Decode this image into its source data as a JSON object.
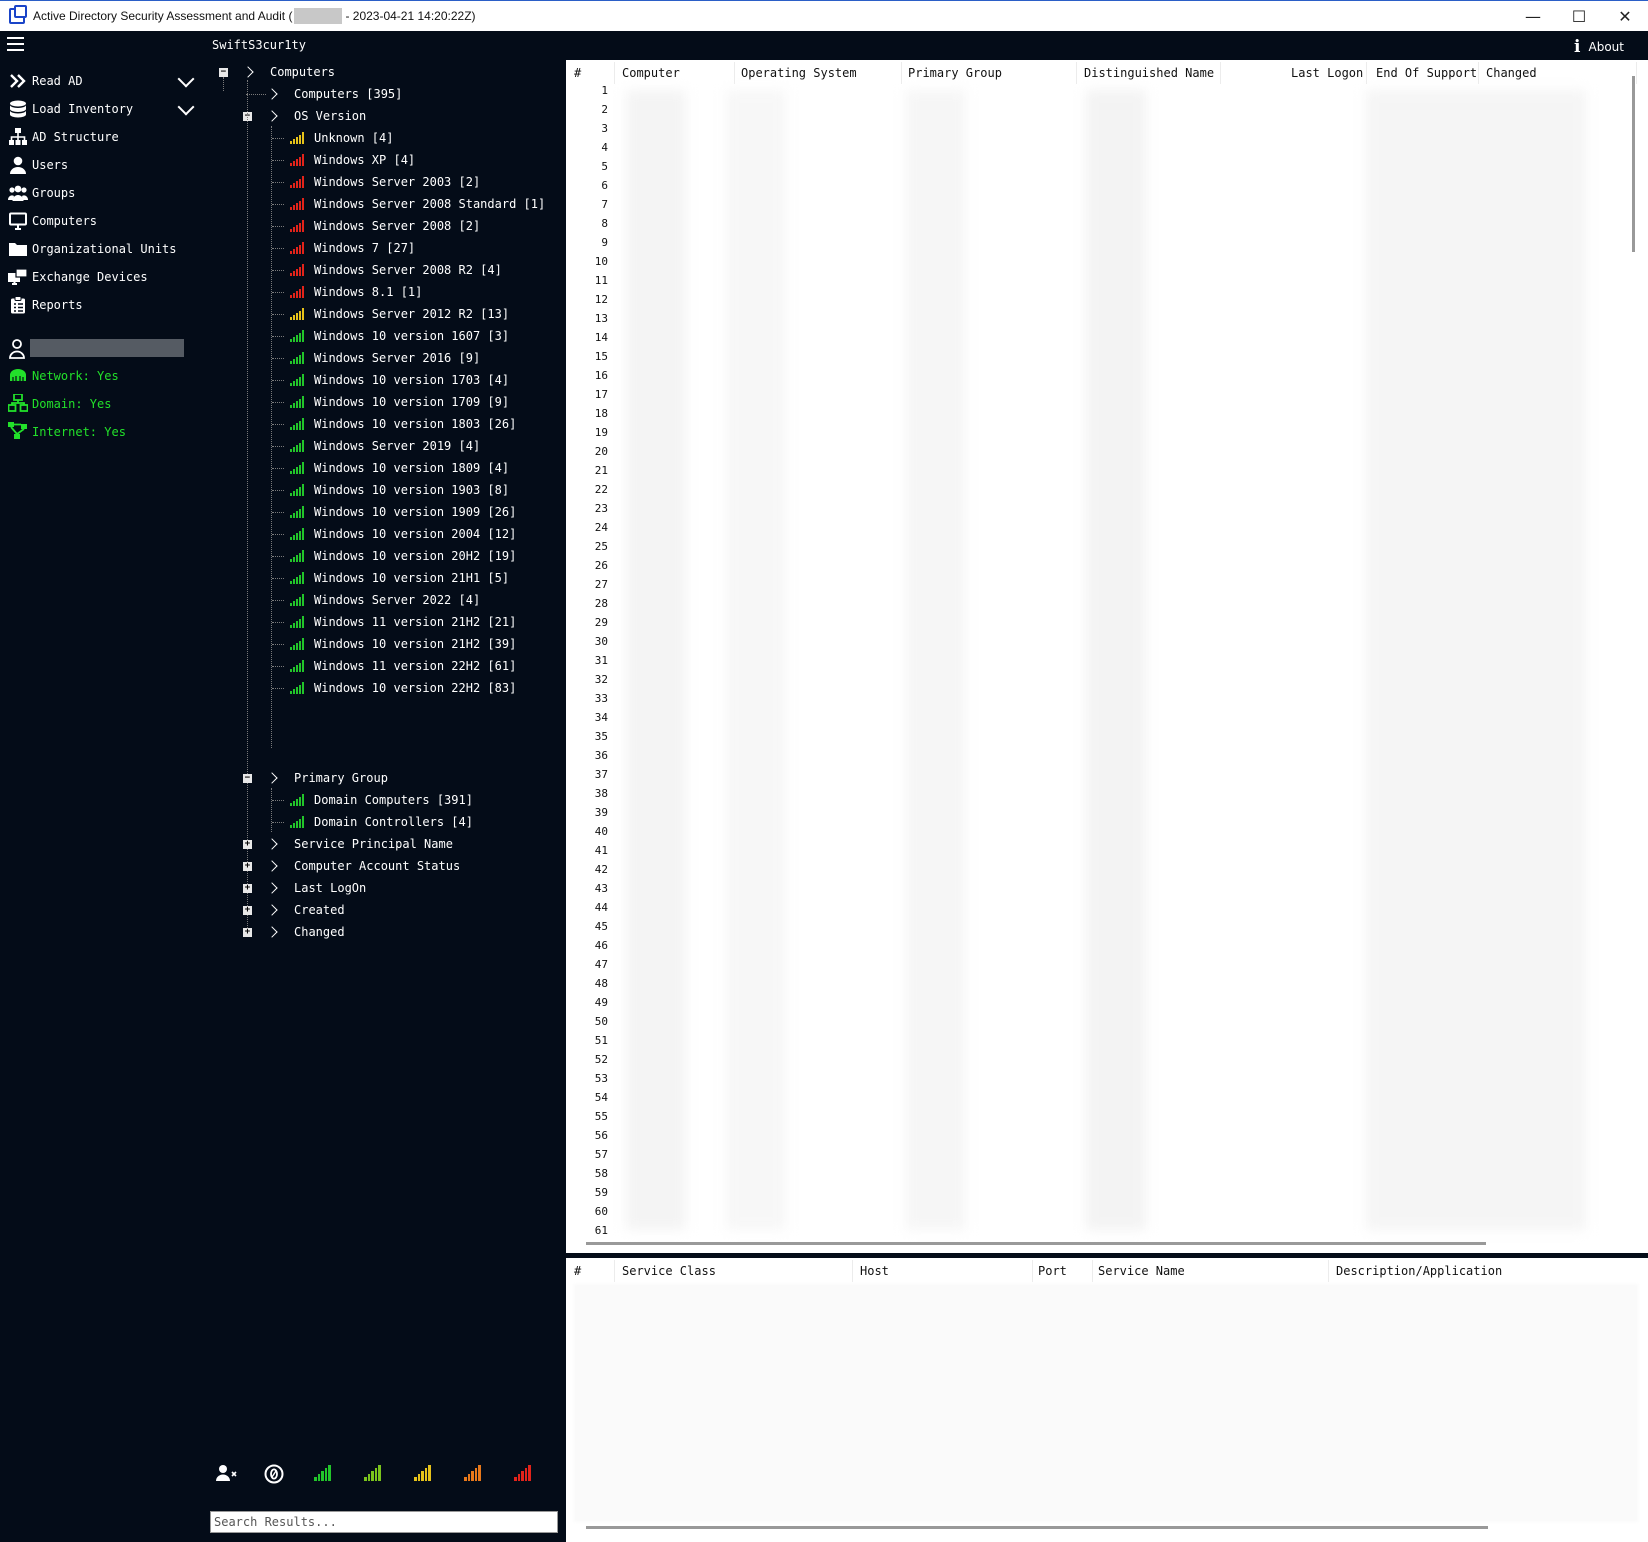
{
  "window": {
    "title_prefix": "Active Directory Security Assessment and Audit (",
    "title_suffix": "- 2023-04-21 14:20:22Z)",
    "controls": {
      "minimize": "—",
      "maximize": "☐",
      "close": "✕"
    }
  },
  "header": {
    "project": "SwiftS3cur1ty",
    "about_label": "About"
  },
  "sidebar": {
    "items": [
      {
        "label": "Read AD",
        "icon": "double-chevron-icon",
        "has_dropdown": true
      },
      {
        "label": "Load Inventory",
        "icon": "database-icon",
        "has_dropdown": true
      },
      {
        "label": "AD Structure",
        "icon": "hierarchy-icon"
      },
      {
        "label": "Users",
        "icon": "user-icon"
      },
      {
        "label": "Groups",
        "icon": "group-icon"
      },
      {
        "label": "Computers",
        "icon": "monitor-icon"
      },
      {
        "label": "Organizational Units",
        "icon": "folder-icon"
      },
      {
        "label": "Exchange Devices",
        "icon": "exchange-icon"
      },
      {
        "label": "Reports",
        "icon": "clipboard-icon"
      }
    ],
    "status": [
      {
        "label": "Network: Yes",
        "icon": "network-icon"
      },
      {
        "label": "Domain: Yes",
        "icon": "domain-icon"
      },
      {
        "label": "Internet: Yes",
        "icon": "internet-icon"
      }
    ],
    "status_color": "#22e02a"
  },
  "tree": {
    "root": "Computers",
    "computers_all": "Computers [395]",
    "os_version": "OS Version",
    "os_items": [
      {
        "label": "Unknown [4]",
        "level": "yellow"
      },
      {
        "label": "Windows XP [4]",
        "level": "red"
      },
      {
        "label": "Windows Server 2003 [2]",
        "level": "red"
      },
      {
        "label": "Windows Server 2008 Standard [1]",
        "level": "red"
      },
      {
        "label": "Windows Server 2008 [2]",
        "level": "red"
      },
      {
        "label": "Windows 7 [27]",
        "level": "red"
      },
      {
        "label": "Windows Server 2008 R2 [4]",
        "level": "red"
      },
      {
        "label": "Windows 8.1 [1]",
        "level": "red"
      },
      {
        "label": "Windows Server 2012 R2 [13]",
        "level": "yellow"
      },
      {
        "label": "Windows 10 version 1607 [3]",
        "level": "green"
      },
      {
        "label": "Windows Server 2016 [9]",
        "level": "green"
      },
      {
        "label": "Windows 10 version 1703 [4]",
        "level": "green"
      },
      {
        "label": "Windows 10 version 1709 [9]",
        "level": "green"
      },
      {
        "label": "Windows 10 version 1803 [26]",
        "level": "green"
      },
      {
        "label": "Windows Server 2019 [4]",
        "level": "green"
      },
      {
        "label": "Windows 10 version 1809 [4]",
        "level": "green"
      },
      {
        "label": "Windows 10 version 1903 [8]",
        "level": "green"
      },
      {
        "label": "Windows 10 version 1909 [26]",
        "level": "green"
      },
      {
        "label": "Windows 10 version 2004 [12]",
        "level": "green"
      },
      {
        "label": "Windows 10 version 20H2 [19]",
        "level": "green"
      },
      {
        "label": "Windows 10 version 21H1 [5]",
        "level": "green"
      },
      {
        "label": "Windows Server 2022 [4]",
        "level": "green"
      },
      {
        "label": "Windows 11 version 21H2 [21]",
        "level": "green"
      },
      {
        "label": "Windows 10 version 21H2 [39]",
        "level": "green"
      },
      {
        "label": "Windows 11 version 22H2 [61]",
        "level": "green"
      },
      {
        "label": "Windows 10 version 22H2 [83]",
        "level": "green"
      }
    ],
    "primary_group": "Primary Group",
    "primary_items": [
      {
        "label": "Domain Computers [391]",
        "level": "green"
      },
      {
        "label": "Domain Controllers [4]",
        "level": "green"
      }
    ],
    "collapsed": [
      "Service Principal Name",
      "Computer Account Status",
      "Last LogOn",
      "Created",
      "Changed"
    ]
  },
  "legend_colors": [
    "#22c52a",
    "#7ac41c",
    "#e6c21a",
    "#e8781a",
    "#e2231a"
  ],
  "level_colors": {
    "green": "#22c52a",
    "yellow": "#e6c21a",
    "red": "#e2231a"
  },
  "search": {
    "placeholder": "Search Results..."
  },
  "main_table": {
    "columns": [
      "#",
      "Computer",
      "Operating System",
      "Primary Group",
      "Distinguished Name",
      "Last Logon",
      "End Of Support",
      "Changed"
    ],
    "row_count": 61
  },
  "spn_table": {
    "columns": [
      "#",
      "Service Class",
      "Host",
      "Port",
      "Service Name",
      "Description/Application"
    ]
  }
}
